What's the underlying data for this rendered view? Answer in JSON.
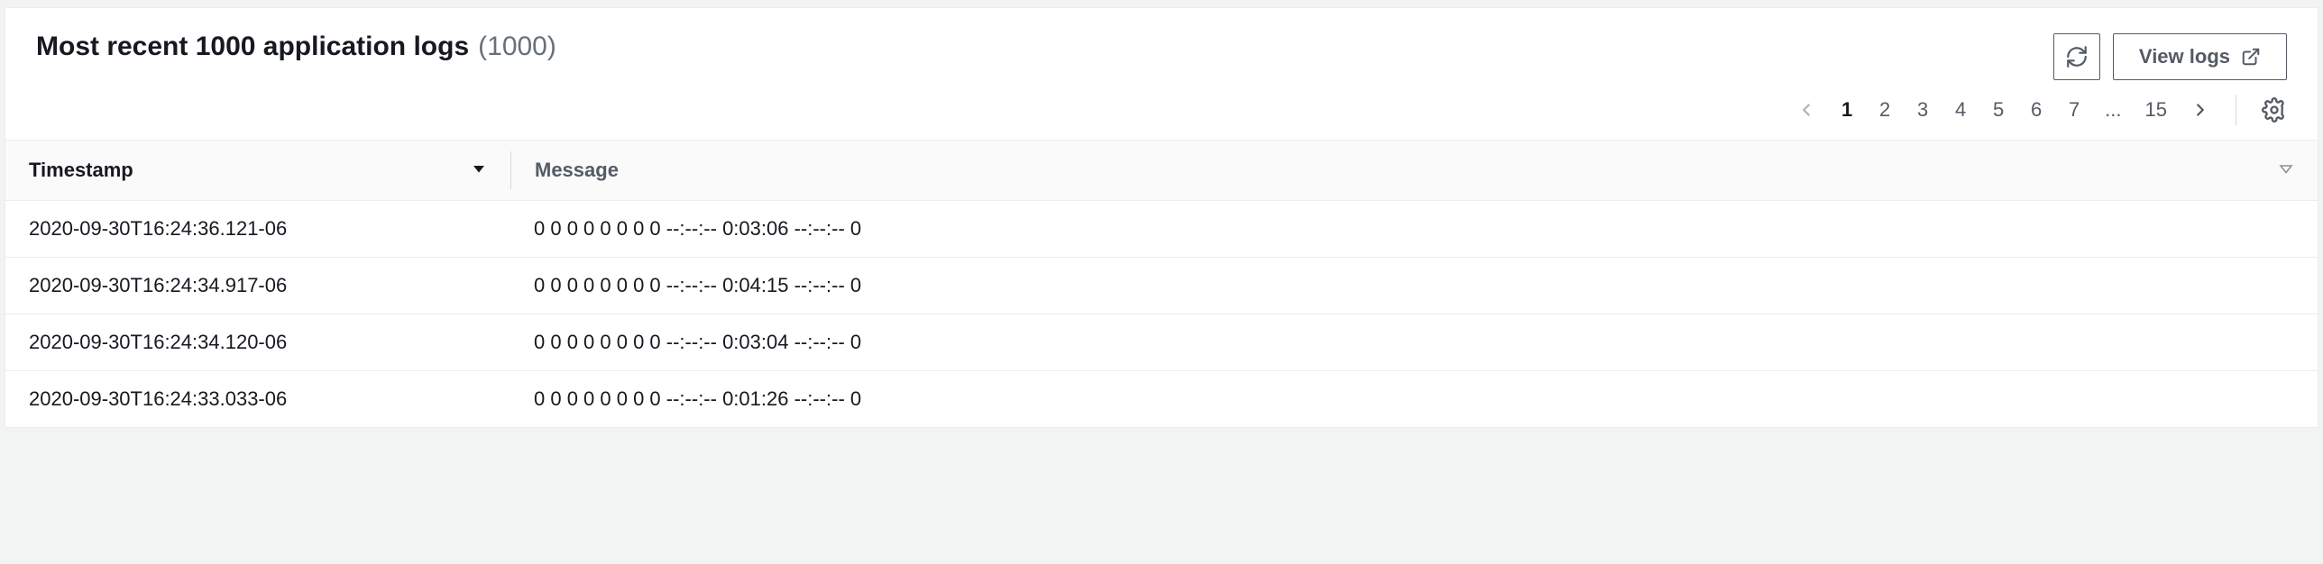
{
  "header": {
    "title": "Most recent 1000 application logs",
    "count": "(1000)",
    "refresh_label": "Refresh",
    "view_logs_label": "View logs"
  },
  "pager": {
    "pages": [
      "1",
      "2",
      "3",
      "4",
      "5",
      "6",
      "7"
    ],
    "ellipsis": "...",
    "last": "15",
    "active_index": 0
  },
  "columns": {
    "timestamp": "Timestamp",
    "message": "Message"
  },
  "rows": [
    {
      "timestamp": "2020-09-30T16:24:36.121-06",
      "message": "0 0 0 0 0 0 0 0 --:--:-- 0:03:06 --:--:-- 0"
    },
    {
      "timestamp": "2020-09-30T16:24:34.917-06",
      "message": "0 0 0 0 0 0 0 0 --:--:-- 0:04:15 --:--:-- 0"
    },
    {
      "timestamp": "2020-09-30T16:24:34.120-06",
      "message": "0 0 0 0 0 0 0 0 --:--:-- 0:03:04 --:--:-- 0"
    },
    {
      "timestamp": "2020-09-30T16:24:33.033-06",
      "message": "0 0 0 0 0 0 0 0 --:--:-- 0:01:26 --:--:-- 0"
    }
  ]
}
